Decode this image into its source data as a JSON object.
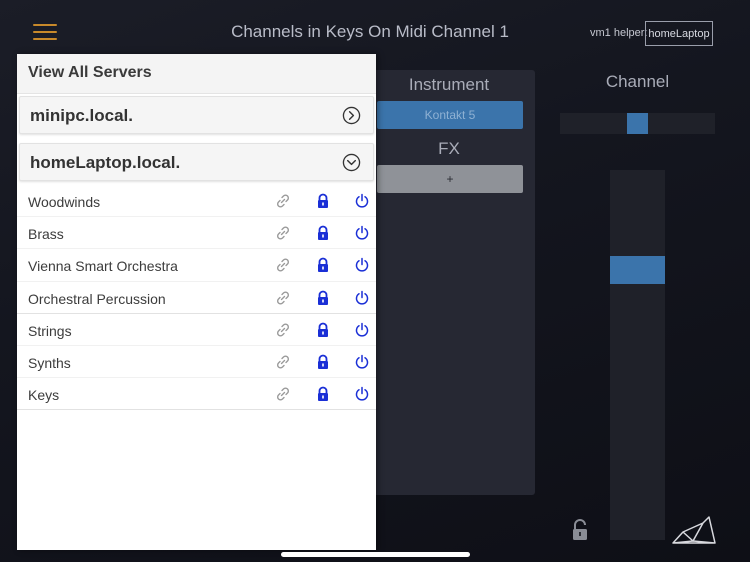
{
  "header": {
    "title": "Channels in Keys On Midi Channel 1",
    "helper_label": "vm1 helper:",
    "helper_value": "homeLaptop"
  },
  "instrument_panel": {
    "title": "Instrument",
    "instrument_button": "Kontakt 5",
    "fx_title": "FX",
    "fx_add_button": "+"
  },
  "channel_panel": {
    "title": "Channel",
    "pan_position": 0.5,
    "fader_level": 0.72
  },
  "drawer": {
    "title": "View All Servers",
    "servers": [
      {
        "name": "minipc.local.",
        "expanded": false
      },
      {
        "name": "homeLaptop.local.",
        "expanded": true
      }
    ],
    "instruments": [
      {
        "name": "Woodwinds"
      },
      {
        "name": "Brass"
      },
      {
        "name": "Vienna Smart Orchestra"
      },
      {
        "name": "Orchestral Percussion"
      },
      {
        "name": "Strings"
      },
      {
        "name": "Synths"
      },
      {
        "name": "Keys"
      }
    ]
  },
  "colors": {
    "accent_orange": "#c8892a",
    "accent_blue": "#3b74ab",
    "icon_blue": "#1a2fd6"
  }
}
